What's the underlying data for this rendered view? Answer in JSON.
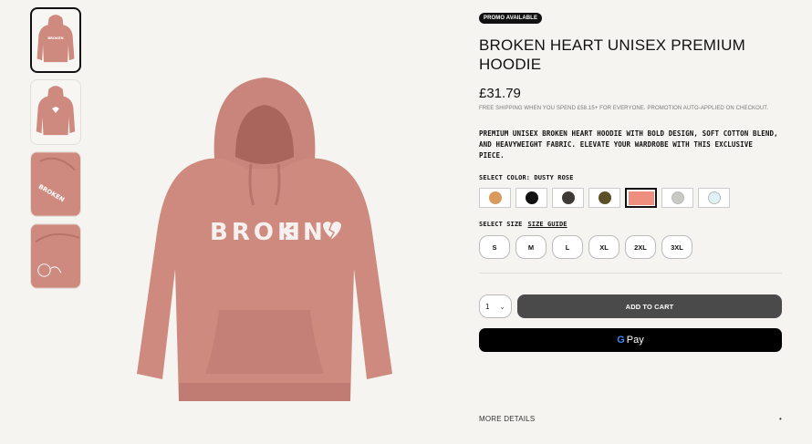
{
  "badge": "PROMO AVAILABLE",
  "title": "BROKEN HEART UNISEX PREMIUM HOODIE",
  "price": "£31.79",
  "shipping": "FREE SHIPPING WHEN YOU SPEND £58.15+ FOR EVERYONE. PROMOTION AUTO-APPLIED ON CHECKOUT.",
  "description": "PREMIUM UNISEX BROKEN HEART HOODIE WITH BOLD DESIGN, SOFT COTTON BLEND, AND HEAVYWEIGHT FABRIC. ELEVATE YOUR WARDROBE WITH THIS EXCLUSIVE PIECE.",
  "color_label": "SELECT COLOR:",
  "color_selected": "DUSTY ROSE",
  "colors": [
    "#d99a5e",
    "#111111",
    "#3d3a38",
    "#5b5028",
    "#ee8e7e",
    "#c8c8c4",
    "#dff3f7"
  ],
  "size_label": "SELECT SIZE",
  "size_guide": "SIZE GUIDE",
  "sizes": [
    "S",
    "M",
    "L",
    "XL",
    "2XL",
    "3XL"
  ],
  "quantity": "1",
  "add_to_cart": "ADD TO CART",
  "gpay": {
    "g": "G",
    "label": "Pay"
  },
  "more_details": "MORE DETAILS",
  "more_toggle": "•",
  "hoodie_print": "BROK",
  "hoodie_print_n": "N",
  "hoodie_print_e": "E",
  "hoodie_color": "#cf8a80"
}
